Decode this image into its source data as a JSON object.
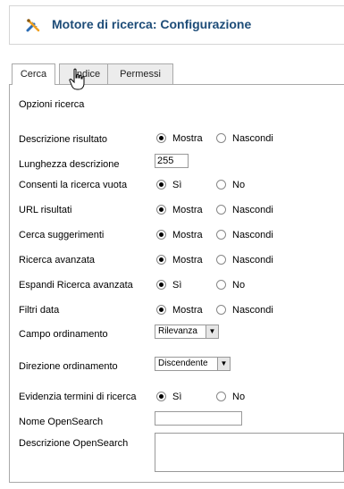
{
  "header": {
    "title": "Motore di ricerca: Configurazione",
    "icon": "tools-icon"
  },
  "tabs": [
    {
      "label": "Cerca",
      "active": true
    },
    {
      "label": "Indice",
      "active": false
    },
    {
      "label": "Permessi",
      "active": false
    }
  ],
  "section_title": "Opzioni ricerca",
  "fields": {
    "descrizione_risultato": {
      "label": "Descrizione risultato",
      "opt1": "Mostra",
      "opt2": "Nascondi",
      "selected": "Mostra"
    },
    "lunghezza_descrizione": {
      "label": "Lunghezza descrizione",
      "value": "255"
    },
    "ricerca_vuota": {
      "label": "Consenti la ricerca vuota",
      "opt1": "Sì",
      "opt2": "No",
      "selected": "Sì"
    },
    "url_risultati": {
      "label": "URL risultati",
      "opt1": "Mostra",
      "opt2": "Nascondi",
      "selected": "Mostra"
    },
    "suggerimenti": {
      "label": "Cerca suggerimenti",
      "opt1": "Mostra",
      "opt2": "Nascondi",
      "selected": "Mostra"
    },
    "ricerca_avanzata": {
      "label": "Ricerca avanzata",
      "opt1": "Mostra",
      "opt2": "Nascondi",
      "selected": "Mostra"
    },
    "espandi_avanzata": {
      "label": "Espandi Ricerca avanzata",
      "opt1": "Sì",
      "opt2": "No",
      "selected": "Sì"
    },
    "filtri_data": {
      "label": "Filtri data",
      "opt1": "Mostra",
      "opt2": "Nascondi",
      "selected": "Mostra"
    },
    "campo_ordinamento": {
      "label": "Campo ordinamento",
      "value": "Rilevanza"
    },
    "direzione_ordinamento": {
      "label": "Direzione ordinamento",
      "value": "Discendente"
    },
    "evidenzia_termini": {
      "label": "Evidenzia termini di ricerca",
      "opt1": "Sì",
      "opt2": "No",
      "selected": "Sì"
    },
    "nome_opensearch": {
      "label": "Nome OpenSearch",
      "value": ""
    },
    "descrizione_opensearch": {
      "label": "Descrizione OpenSearch",
      "value": ""
    }
  },
  "colors": {
    "title": "#1d4c78",
    "border": "#a9a9a9",
    "tab_inactive": "#ececec"
  }
}
